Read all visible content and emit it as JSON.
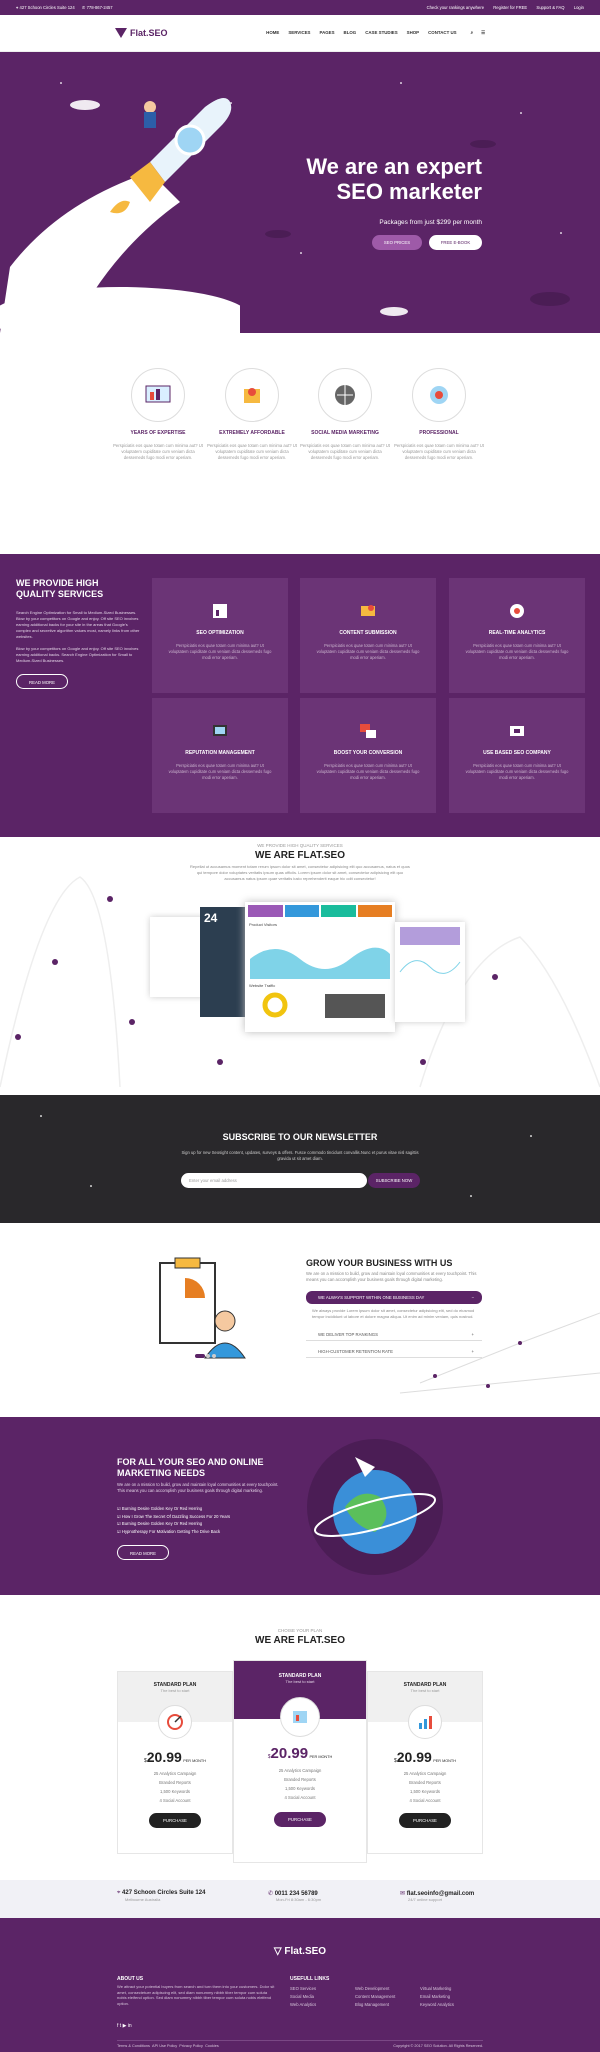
{
  "topbar": {
    "address": "427 Schoon Circles Suite 124",
    "phone": "778-867-2457",
    "links": [
      "Check your rankings anywhere",
      "Register for FREE",
      "Support & FAQ",
      "Login"
    ]
  },
  "nav": {
    "logo": "Flat.SEO",
    "items": [
      "HOME",
      "SERVICES",
      "PAGES",
      "BLOG",
      "CASE STUDIES",
      "SHOP",
      "CONTACT US"
    ]
  },
  "hero": {
    "title_1": "We are an expert",
    "title_2": "SEO marketer",
    "packages": "Packages from just $299 per month",
    "btn_prices": "SEO PRICES",
    "btn_ebook": "FREE E-BOOK"
  },
  "features": [
    {
      "title": "YEARS OF EXPERTISE",
      "text": "Perspiciatis eos quae totam cum minima aut? Ut voluptatem cupiditate cum veniam dicta dessemeds fugo modi error aperiam."
    },
    {
      "title": "EXTREMELY AFFORDABLE",
      "text": "Perspiciatis eos quae totam cum minima aut? Ut voluptatem cupiditate cum veniam dicta dessemeds fugo modi error aperiam."
    },
    {
      "title": "SOCIAL MEDIA MARKETING",
      "text": "Perspiciatis eos quae totam cum minima aut? Ut voluptatem cupiditate cum veniam dicta dessemeds fugo modi error aperiam."
    },
    {
      "title": "PROFESSIONAL",
      "text": "Perspiciatis eos quae totam cum minima aut? Ut voluptatem cupiditate cum veniam dicta dessemeds fugo modi error aperiam."
    }
  ],
  "services": {
    "heading_1": "WE PROVIDE HIGH",
    "heading_2": "QUALITY SERVICES",
    "desc_1": "Search Engine Optimization for Small to Medium-Sized Businesses. Blow by your competitors on Google and enjoy. Off site SEO involves earning additional backs for your site in the areas that Google's complex and secretive algorithm values most, namely links from other websites.",
    "desc_2": "Blow by your competitors on Google and enjoy. Off site SEO involves earning additional backs. Search Engine Optimization for Small to Medium-Sized Businesses.",
    "btn": "READ MORE",
    "card_text": "Perspiciatis eos quae totam cum minima aut? Ut voluptatem cupiditate cum veniam dicta dessemeds fugo modi error aperiam.",
    "cards": [
      "SEO OPTIMIZATION",
      "CONTENT SUBMISSION",
      "REAL-TIME ANALYTICS",
      "REPUTATION MANAGEMENT",
      "BOOST YOUR CONVERSION",
      "USE BASED SEO COMPANY"
    ]
  },
  "about": {
    "kicker": "WE PROVIDE HIGH QUALITY SERVICES",
    "title": "WE ARE FLAT.SEO",
    "text": "Repellat ut accusamus moment totam rerum ipsum dolor sit amet, consectetur adipisicing elit quo accusamus, natus et quos qui tempore dolor voluptates veritatis ipsum quas officiis. Lorem ipsum dolor sit amet, consectetur adipisicing elit quo accusamus natus ipsum quae veritatis iusto reprehenderit eaque hic odit consectetur!",
    "dash_day": "24",
    "dash_label": "Product Visitors",
    "dash_traffic": "Website Traffic"
  },
  "newsletter": {
    "title": "SUBSCRIBE TO OUR NEWSLETTER",
    "text": "Sign up for new Seosight content, updates, surveys & offers. Fusce commodo tincidunt convallis.Nunc et purus vitae nisl sagittis gravida ut sit amet diam.",
    "placeholder": "Enter your email address",
    "btn": "SUBSCRIBE NOW"
  },
  "grow": {
    "title": "GROW YOUR BUSINESS WITH US",
    "text": "We are on a mission to build, grow and maintain loyal communities at every touchpoint. This means you can accomplish your business goals through digital marketing.",
    "acc": [
      "WE ALWAYS SUPPORT WITHIN ONE BUSINESS DAY",
      "WE DELIVER TOP RANKINGS",
      "HIGH-CUSTOMER RETENTION RATE"
    ],
    "acc_body": "We always provide Lorem ipsum dolor sit amet, consectetur adipisicing elit, sed do eiusmod tempor incididunt ut labore et dolore magna aliqua. Ut enim ad minim veniam, quis nostrud."
  },
  "market": {
    "title_1": "FOR ALL YOUR SEO AND ONLINE",
    "title_2": "MARKETING NEEDS",
    "text": "We are on a mission to build, grow and maintain loyal communities at every touchpoint. This means you can accomplish your business goals through digital marketing.",
    "bullets": [
      "Burning Desire Golden Key Or Red Herring",
      "How I Grow The Secret Of Dazzling Success For 20 Years",
      "Burning Desire Golden Key Or Red Herring",
      "Hypnotherapy For Motivation Getting The Drive Back"
    ],
    "btn": "READ MORE"
  },
  "pricing": {
    "kicker": "CHOISE YOUR PLAN",
    "title": "WE ARE FLAT.SEO",
    "plans": [
      {
        "name": "STANDARD PLAN",
        "sub": "The best to start",
        "price": "20.99",
        "cur": "$",
        "per": "PER MONTH",
        "btn": "PURCHASE"
      },
      {
        "name": "STANDARD PLAN",
        "sub": "The best to start",
        "price": "20.99",
        "cur": "$",
        "per": "PER MONTH",
        "btn": "PURCHASE"
      },
      {
        "name": "STANDARD PLAN",
        "sub": "The best to start",
        "price": "20.99",
        "cur": "$",
        "per": "PER MONTH",
        "btn": "PURCHASE"
      }
    ],
    "features": [
      "25 Analytics Campaign",
      "Branded Reports",
      "1,500 Keywords",
      "4 Social Account"
    ]
  },
  "contact": {
    "addr": "427 Schoon Circles Suite 124",
    "addr2": "Melbourne Australia",
    "phone": "0011 234 56789",
    "phone2": "Mon-Fri 8:30am - 6:30pm",
    "email": "flat.seoinfo@gmail.com",
    "email2": "24/7 online support"
  },
  "footer": {
    "logo": "Flat.SEO",
    "about_title": "ABOUT US",
    "about_text": "We attract your potential buyers from search and turn them into your customers. Dolor sit amet, consectetuer adipiscing elit, sed diam nonummy nibbh tiber tempor cum soluta nobis eleifend option. Sed diam nonummy nibbh tiber tempor cum soluta nobis eleifend option.",
    "links_title": "USEFULL LINKS",
    "links": [
      "SEO Services",
      "Web Development",
      "Virtual Marketing",
      "Social Media",
      "Content Management",
      "Email Marketing",
      "Web Analytics",
      "Blog Management",
      "Keyword Analytics"
    ],
    "bottom": [
      "Terms & Conditions",
      "API Use Policy",
      "Privacy Policy",
      "Cookies"
    ],
    "copyright": "Copyright © 2017 SEO Solution. All Rights Reserved."
  }
}
